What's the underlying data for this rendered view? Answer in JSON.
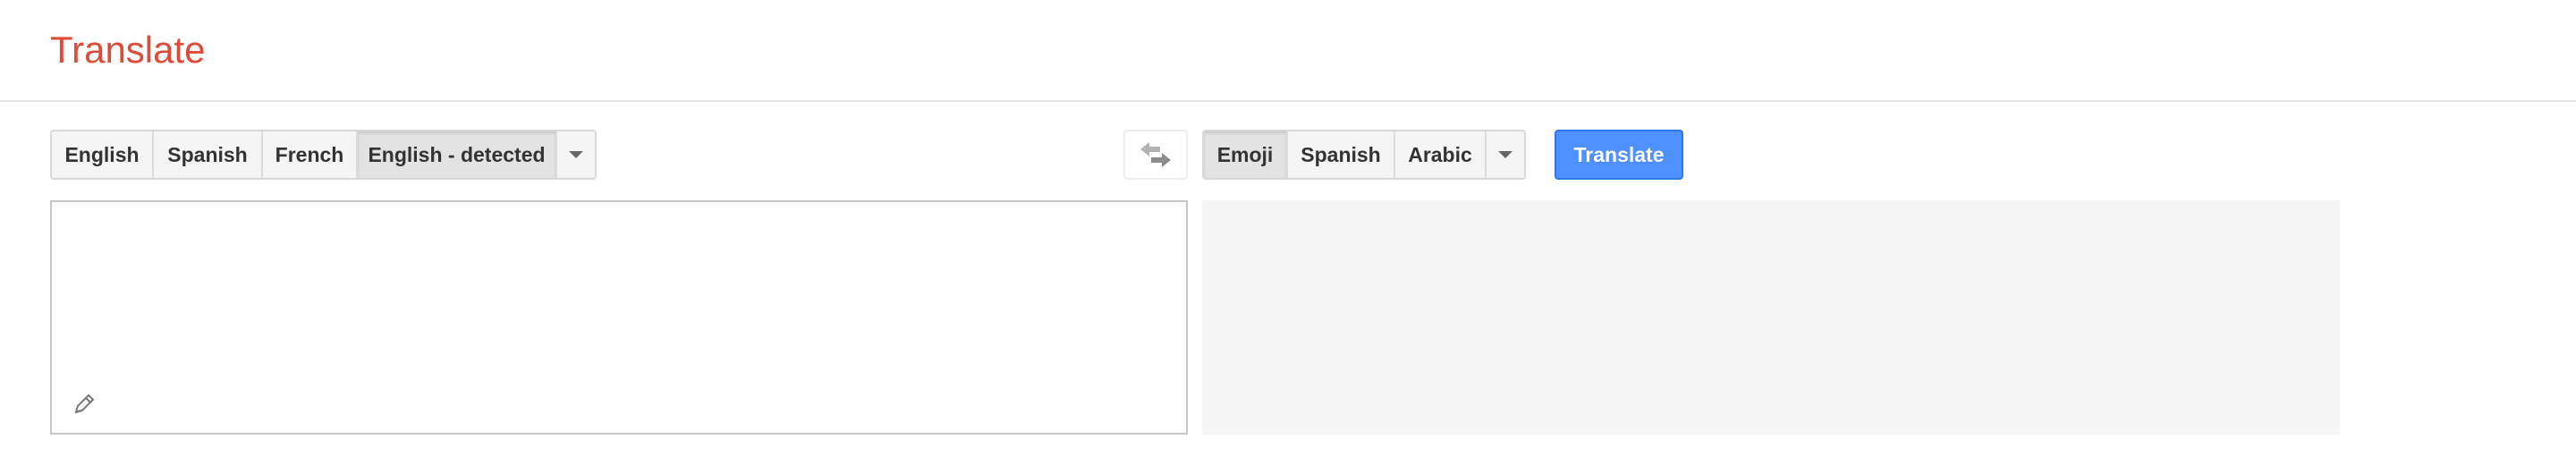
{
  "header": {
    "title": "Translate"
  },
  "source_languages": {
    "buttons": [
      {
        "label": "English",
        "selected": false
      },
      {
        "label": "Spanish",
        "selected": false
      },
      {
        "label": "French",
        "selected": false
      },
      {
        "label": "English - detected",
        "selected": true
      }
    ],
    "dropdown_icon": "chevron-down-icon"
  },
  "swap": {
    "icon": "swap-arrows-icon"
  },
  "target_languages": {
    "buttons": [
      {
        "label": "Emoji",
        "selected": true
      },
      {
        "label": "Spanish",
        "selected": false
      },
      {
        "label": "Arabic",
        "selected": false
      }
    ],
    "dropdown_icon": "chevron-down-icon"
  },
  "translate_button": {
    "label": "Translate"
  },
  "source_input": {
    "value": "",
    "placeholder": "",
    "icon": "pencil-icon"
  },
  "target_output": {
    "text": ""
  },
  "colors": {
    "title": "#dd4b39",
    "translate_button": "#4d90fe",
    "output_background": "#f5f5f5"
  }
}
